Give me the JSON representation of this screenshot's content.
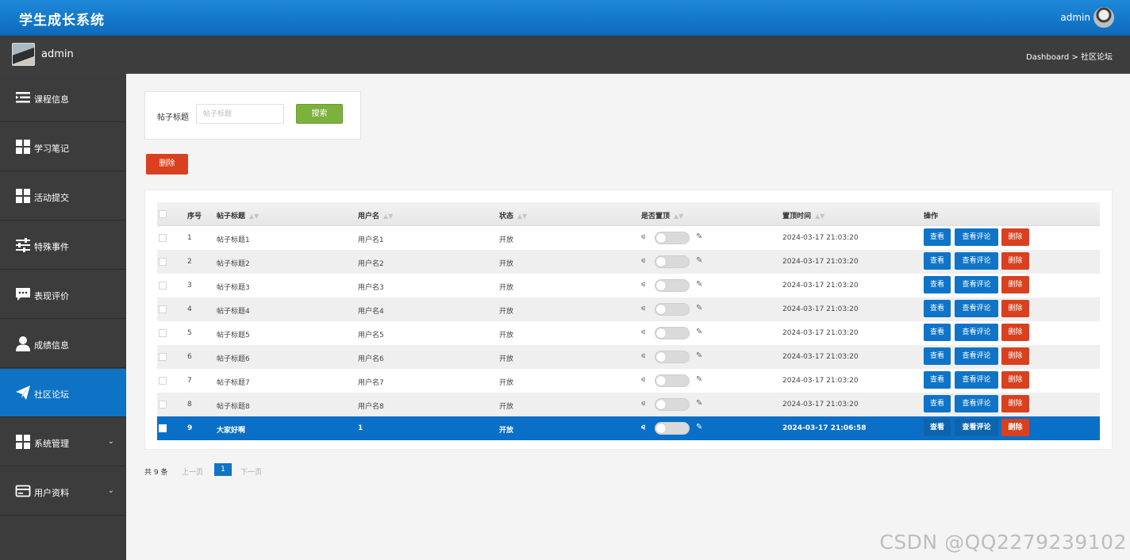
{
  "header": {
    "app_title": "学生成长系统",
    "user": "admin"
  },
  "subbar": {
    "user": "admin",
    "breadcrumb": "Dashboard > 社区论坛"
  },
  "sidebar": {
    "items": [
      {
        "label": "课程信息",
        "icon": "list-icon",
        "active": false,
        "has_chevron": false
      },
      {
        "label": "学习笔记",
        "icon": "grid-icon",
        "active": false,
        "has_chevron": false
      },
      {
        "label": "活动提交",
        "icon": "grid-icon",
        "active": false,
        "has_chevron": false
      },
      {
        "label": "特殊事件",
        "icon": "sliders-icon",
        "active": false,
        "has_chevron": false
      },
      {
        "label": "表现评价",
        "icon": "comment-icon",
        "active": false,
        "has_chevron": false
      },
      {
        "label": "成绩信息",
        "icon": "user-icon",
        "active": false,
        "has_chevron": false
      },
      {
        "label": "社区论坛",
        "icon": "paper-plane-icon",
        "active": true,
        "has_chevron": false
      },
      {
        "label": "系统管理",
        "icon": "grid-icon",
        "active": false,
        "has_chevron": true
      },
      {
        "label": "用户资料",
        "icon": "card-icon",
        "active": false,
        "has_chevron": true
      }
    ]
  },
  "search": {
    "label": "帖子标题",
    "placeholder": "帖子标题",
    "button": "搜索"
  },
  "bulk_delete": "删除",
  "table": {
    "columns": [
      "序号",
      "帖子标题",
      "用户名",
      "状态",
      "是否置顶",
      "置顶时间",
      "操作"
    ],
    "rows": [
      {
        "no": "1",
        "title": "帖子标题1",
        "user": "用户名1",
        "status": "开放",
        "time": "2024-03-17 21:03:20"
      },
      {
        "no": "2",
        "title": "帖子标题2",
        "user": "用户名2",
        "status": "开放",
        "time": "2024-03-17 21:03:20"
      },
      {
        "no": "3",
        "title": "帖子标题3",
        "user": "用户名3",
        "status": "开放",
        "time": "2024-03-17 21:03:20"
      },
      {
        "no": "4",
        "title": "帖子标题4",
        "user": "用户名4",
        "status": "开放",
        "time": "2024-03-17 21:03:20"
      },
      {
        "no": "5",
        "title": "帖子标题5",
        "user": "用户名5",
        "status": "开放",
        "time": "2024-03-17 21:03:20"
      },
      {
        "no": "6",
        "title": "帖子标题6",
        "user": "用户名6",
        "status": "开放",
        "time": "2024-03-17 21:03:20"
      },
      {
        "no": "7",
        "title": "帖子标题7",
        "user": "用户名7",
        "status": "开放",
        "time": "2024-03-17 21:03:20"
      },
      {
        "no": "8",
        "title": "帖子标题8",
        "user": "用户名8",
        "status": "开放",
        "time": "2024-03-17 21:03:20"
      },
      {
        "no": "9",
        "title": "大家好啊",
        "user": "1",
        "status": "开放",
        "time": "2024-03-17 21:06:58",
        "selected": true
      }
    ],
    "actions": {
      "view": "查看",
      "comments": "查看评论",
      "delete": "删除"
    }
  },
  "pager": {
    "total": "共 9 条",
    "prev": "上一页",
    "current": "1",
    "next": "下一页"
  },
  "watermark": "CSDN @QQ2279239102",
  "colors": {
    "primary": "#0f74c7",
    "danger": "#d9401f",
    "success": "#7cb13c",
    "sidebar": "#3c3c3c",
    "header": "#1a80d0"
  }
}
